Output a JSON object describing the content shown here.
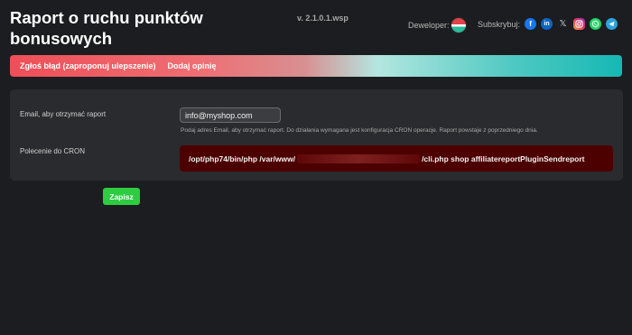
{
  "header": {
    "title": "Raport o ruchu punktów bonusowych",
    "version": "v. 2.1.0.1.wsp",
    "developer_label": "Deweloper:",
    "subscribe_label": "Subskrybuj:",
    "social_icons": [
      "facebook-icon",
      "linkedin-icon",
      "x-icon",
      "instagram-icon",
      "whatsapp-icon",
      "telegram-icon"
    ]
  },
  "banner": {
    "report_bug": "Zgłoś błąd (zaproponuj ulepszenie)",
    "add_review": "Dodaj opinię"
  },
  "form": {
    "email_label": "Email, aby otrzymać raport",
    "email_value": "info@myshop.com",
    "email_help": "Podaj adres Email, aby otrzymać raport. Do działania wymagana jest konfiguracja CRON operacje. Raport powstaje z poprzedniego dnia.",
    "cron_label": "Polecenie do CRON",
    "cron_prefix": "/opt/php74/bin/php /var/www/",
    "cron_suffix": "/cli.php shop affiliatereportPluginSendreport"
  },
  "actions": {
    "save_label": "Zapisz"
  },
  "colors": {
    "background": "#1c1d20",
    "card": "#2a2b2e",
    "banner_start": "#ee4f57",
    "banner_end": "#16b8b3",
    "cron_bg": "#4d0000",
    "save_button": "#2ecc40"
  }
}
